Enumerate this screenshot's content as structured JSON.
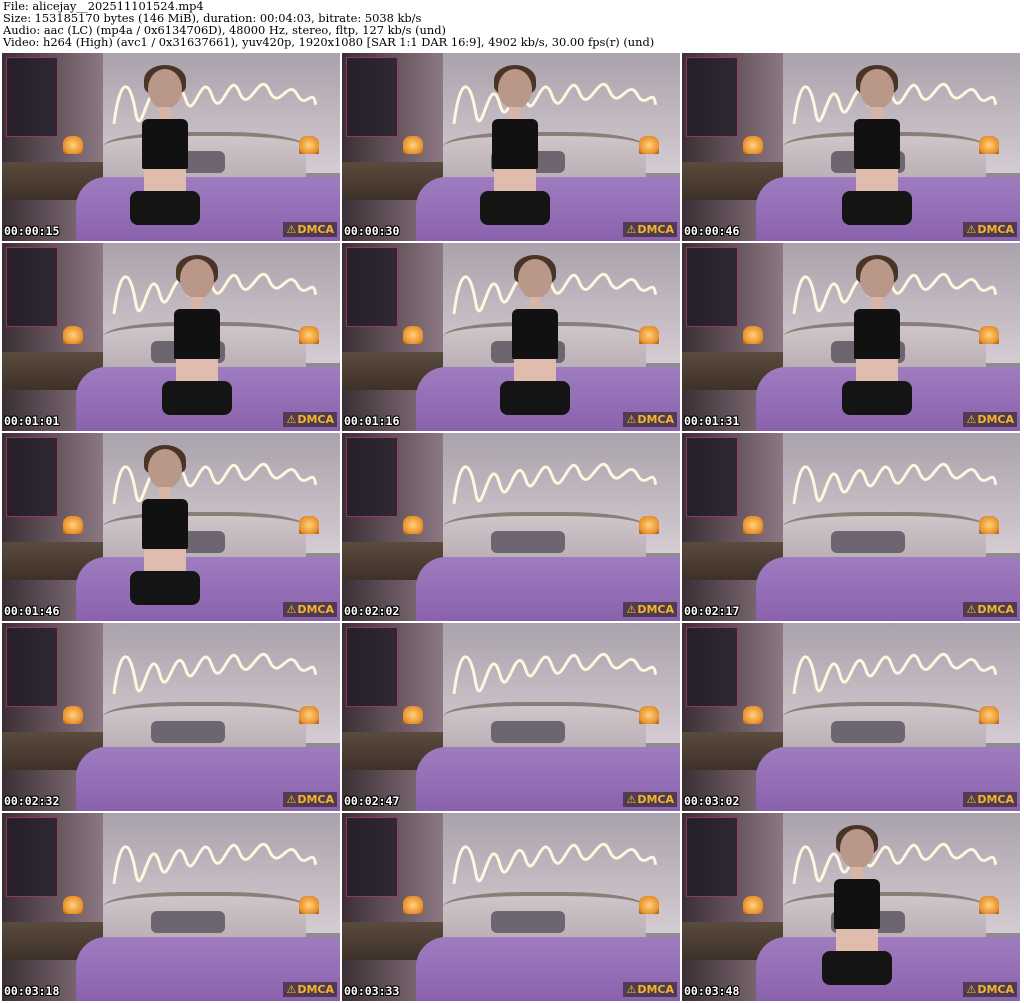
{
  "header": {
    "file_line": "File: alicejay__202511101524.mp4",
    "size_line": "Size: 153185170 bytes (146 MiB), duration: 00:04:03, bitrate: 5038 kb/s",
    "audio_line": "Audio: aac (LC) (mp4a / 0x6134706D), 48000 Hz, stereo, fltp, 127 kb/s (und)",
    "video_line": "Video: h264 (High) (avc1 / 0x31637661), yuv420p, 1920x1080 [SAR 1:1 DAR 16:9], 4902 kb/s, 30.00 fps(r) (und)"
  },
  "watermark": "DMCA",
  "frames": [
    {
      "time": "00:00:15",
      "person": true
    },
    {
      "time": "00:00:30",
      "person": true
    },
    {
      "time": "00:00:46",
      "person": true
    },
    {
      "time": "00:01:01",
      "person": true
    },
    {
      "time": "00:01:16",
      "person": true
    },
    {
      "time": "00:01:31",
      "person": true
    },
    {
      "time": "00:01:46",
      "person": true
    },
    {
      "time": "00:02:02",
      "person": false
    },
    {
      "time": "00:02:17",
      "person": false
    },
    {
      "time": "00:02:32",
      "person": false
    },
    {
      "time": "00:02:47",
      "person": false
    },
    {
      "time": "00:03:02",
      "person": false
    },
    {
      "time": "00:03:18",
      "person": false
    },
    {
      "time": "00:03:33",
      "person": false
    },
    {
      "time": "00:03:48",
      "person": true
    }
  ]
}
